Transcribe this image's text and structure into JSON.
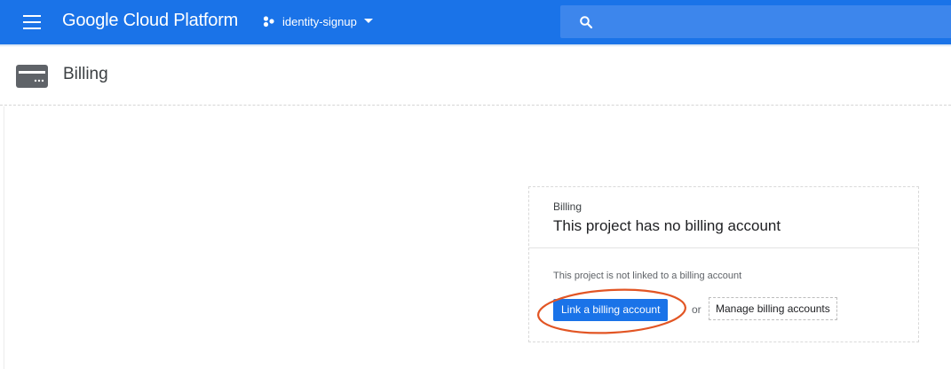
{
  "topbar": {
    "app_title": "Google Cloud Platform",
    "project_name": "identity-signup",
    "menu_icon": "hamburger-menu-icon",
    "project_icon": "project-dots-icon",
    "dropdown_icon": "caret-down-icon",
    "search_icon": "search-icon",
    "brand_color": "#1a73e8"
  },
  "page_header": {
    "icon": "billing-card-icon",
    "title": "Billing"
  },
  "card": {
    "kicker": "Billing",
    "title": "This project has no billing account",
    "message": "This project is not linked to a billing account",
    "link_button_label": "Link a billing account",
    "separator": "or",
    "manage_button_label": "Manage billing accounts"
  },
  "annotation": {
    "shape": "ellipse",
    "color": "#e25524",
    "target": "link-billing-account-button"
  }
}
